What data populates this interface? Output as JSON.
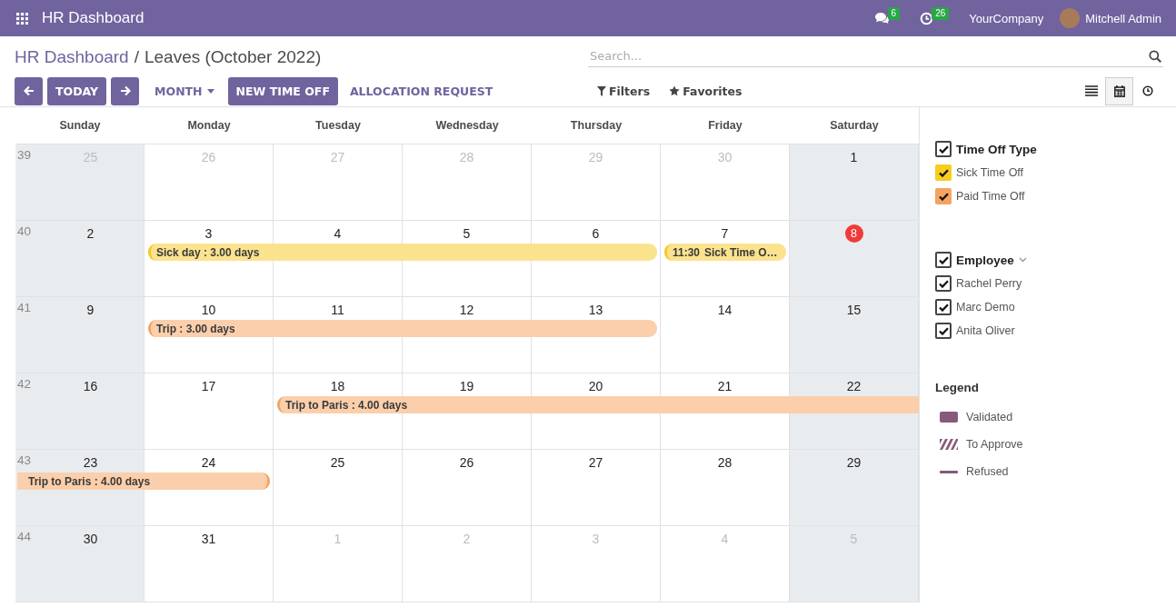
{
  "navbar": {
    "app_title": "HR Dashboard",
    "messages_count": "6",
    "activities_count": "26",
    "company": "YourCompany",
    "user": "Mitchell Admin"
  },
  "breadcrumb": {
    "parent": "HR Dashboard",
    "separator": "/",
    "current": "Leaves (October 2022)"
  },
  "search": {
    "placeholder": "Search..."
  },
  "toolbar": [
    {
      "kind": "prev"
    },
    {
      "kind": "primary",
      "label": "TODAY"
    },
    {
      "kind": "next"
    },
    {
      "kind": "dropdown",
      "label": "MONTH"
    },
    {
      "kind": "primary",
      "label": "NEW TIME OFF"
    },
    {
      "kind": "link",
      "label": "ALLOCATION REQUEST"
    }
  ],
  "search_options": [
    {
      "kind": "filter",
      "label": "Filters"
    },
    {
      "kind": "favorite",
      "label": "Favorites"
    }
  ],
  "views": [
    {
      "kind": "list",
      "selected": false
    },
    {
      "kind": "calendar",
      "selected": true
    },
    {
      "kind": "activity",
      "selected": false
    }
  ],
  "calendar": {
    "weekdays": [
      "Sunday",
      "Monday",
      "Tuesday",
      "Wednesday",
      "Thursday",
      "Friday",
      "Saturday"
    ],
    "weeks": [
      {
        "number": "39",
        "days": [
          {
            "label": "25",
            "outside": true,
            "today": false
          },
          {
            "label": "26",
            "outside": true,
            "today": false
          },
          {
            "label": "27",
            "outside": true,
            "today": false
          },
          {
            "label": "28",
            "outside": true,
            "today": false
          },
          {
            "label": "29",
            "outside": true,
            "today": false
          },
          {
            "label": "30",
            "outside": true,
            "today": false
          },
          {
            "label": "1",
            "outside": false,
            "today": false
          }
        ]
      },
      {
        "number": "40",
        "days": [
          {
            "label": "2",
            "outside": false,
            "today": false
          },
          {
            "label": "3",
            "outside": false,
            "today": false,
            "bar": {
              "kind": "sick",
              "text": "Sick day : 3.00 days"
            }
          },
          {
            "label": "4",
            "outside": false,
            "today": false,
            "bar": {
              "kind": "sick"
            }
          },
          {
            "label": "5",
            "outside": false,
            "today": false,
            "bar": {
              "kind": "sick"
            }
          },
          {
            "label": "6",
            "outside": false,
            "today": false,
            "bar": {
              "kind": "sick"
            }
          },
          {
            "label": "7",
            "outside": false,
            "today": false,
            "bar": {
              "kind": "sick",
              "time": "11:30",
              "text": "Sick Time O…"
            }
          },
          {
            "label": "8",
            "outside": false,
            "today": true
          }
        ]
      },
      {
        "number": "41",
        "days": [
          {
            "label": "9",
            "outside": false,
            "today": false
          },
          {
            "label": "10",
            "outside": false,
            "today": false,
            "bar": {
              "kind": "paid",
              "text": "Trip : 3.00 days"
            }
          },
          {
            "label": "11",
            "outside": false,
            "today": false,
            "bar": {
              "kind": "paid"
            }
          },
          {
            "label": "12",
            "outside": false,
            "today": false,
            "bar": {
              "kind": "paid"
            }
          },
          {
            "label": "13",
            "outside": false,
            "today": false,
            "bar": {
              "kind": "paid"
            }
          },
          {
            "label": "14",
            "outside": false,
            "today": false
          },
          {
            "label": "15",
            "outside": false,
            "today": false
          }
        ]
      },
      {
        "number": "42",
        "days": [
          {
            "label": "16",
            "outside": false,
            "today": false
          },
          {
            "label": "17",
            "outside": false,
            "today": false
          },
          {
            "label": "18",
            "outside": false,
            "today": false,
            "bar": {
              "kind": "paid",
              "text": "Trip to Paris : 4.00 days"
            }
          },
          {
            "label": "19",
            "outside": false,
            "today": false,
            "bar": {
              "kind": "paid"
            }
          },
          {
            "label": "20",
            "outside": false,
            "today": false,
            "bar": {
              "kind": "paid"
            }
          },
          {
            "label": "21",
            "outside": false,
            "today": false,
            "bar": {
              "kind": "paid"
            }
          },
          {
            "label": "22",
            "outside": false,
            "today": false,
            "bar": {
              "kind": "paid"
            }
          }
        ]
      },
      {
        "number": "43",
        "days": [
          {
            "label": "23",
            "outside": false,
            "today": false,
            "bar": {
              "kind": "paid",
              "text": "Trip to Paris : 4.00 days"
            }
          },
          {
            "label": "24",
            "outside": false,
            "today": false,
            "bar": {
              "kind": "paid"
            }
          },
          {
            "label": "25",
            "outside": false,
            "today": false
          },
          {
            "label": "26",
            "outside": false,
            "today": false
          },
          {
            "label": "27",
            "outside": false,
            "today": false
          },
          {
            "label": "28",
            "outside": false,
            "today": false
          },
          {
            "label": "29",
            "outside": false,
            "today": false
          }
        ]
      },
      {
        "number": "44",
        "days": [
          {
            "label": "30",
            "outside": false,
            "today": false
          },
          {
            "label": "31",
            "outside": false,
            "today": false
          },
          {
            "label": "1",
            "outside": true,
            "today": false
          },
          {
            "label": "2",
            "outside": true,
            "today": false
          },
          {
            "label": "3",
            "outside": true,
            "today": false
          },
          {
            "label": "4",
            "outside": true,
            "today": false
          },
          {
            "label": "5",
            "outside": true,
            "today": false
          }
        ]
      }
    ]
  },
  "sidebar": {
    "filter_groups": [
      {
        "title": "Time Off Type",
        "checked": true,
        "collapsible": false,
        "items": [
          {
            "label": "Sick Time Off",
            "checked": true,
            "color": "#f7cd1f"
          },
          {
            "label": "Paid Time Off",
            "checked": true,
            "color": "#f4a460"
          }
        ]
      },
      {
        "title": "Employee",
        "checked": true,
        "collapsible": true,
        "items": [
          {
            "label": "Rachel Perry",
            "checked": true
          },
          {
            "label": "Marc Demo",
            "checked": true
          },
          {
            "label": "Anita Oliver",
            "checked": true
          }
        ]
      }
    ],
    "legend": {
      "title": "Legend",
      "items": [
        {
          "kind": "validated",
          "label": "Validated"
        },
        {
          "kind": "to_approve",
          "label": "To Approve"
        },
        {
          "kind": "refused",
          "label": "Refused"
        }
      ]
    }
  }
}
